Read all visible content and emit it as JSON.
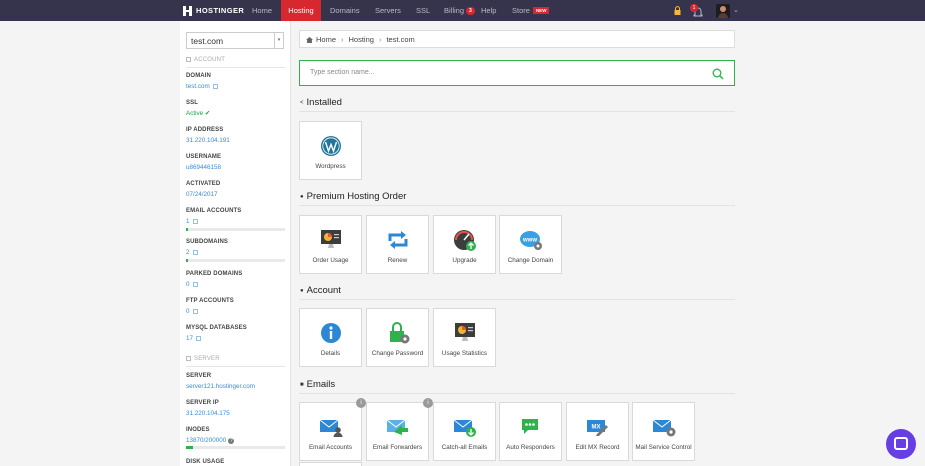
{
  "topnav": {
    "brand": "HOSTINGER",
    "items": [
      {
        "label": "Home"
      },
      {
        "label": "Hosting"
      },
      {
        "label": "Domains"
      },
      {
        "label": "Servers"
      },
      {
        "label": "SSL"
      },
      {
        "label": "Billing",
        "badge": "3"
      },
      {
        "label": "Help"
      },
      {
        "label": "Store",
        "badge": "NEW"
      }
    ],
    "active": "Hosting",
    "notifications_count": "1"
  },
  "sidebar": {
    "selected_domain": "test.com",
    "account_heading": "ACCOUNT",
    "fields": [
      {
        "label": "DOMAIN",
        "value": "test.com"
      },
      {
        "label": "SSL",
        "value": "Active"
      },
      {
        "label": "IP ADDRESS",
        "value": "31.220.104.191"
      },
      {
        "label": "USERNAME",
        "value": "u869446158"
      },
      {
        "label": "ACTIVATED",
        "value": "07/24/2017"
      },
      {
        "label": "EMAIL ACCOUNTS",
        "value": "1"
      },
      {
        "label": "SUBDOMAINS",
        "value": "2"
      },
      {
        "label": "PARKED DOMAINS",
        "value": "0"
      },
      {
        "label": "FTP ACCOUNTS",
        "value": "0"
      },
      {
        "label": "MYSQL DATABASES",
        "value": "17"
      }
    ],
    "usage": {
      "email_accounts": 0.01,
      "subdomains": 0.02,
      "inodes": 0.07
    },
    "server_heading": "SERVER",
    "server_fields": [
      {
        "label": "SERVER",
        "value": "server121.hostinger.com"
      },
      {
        "label": "SERVER IP",
        "value": "31.220.104.175"
      },
      {
        "label": "INODES",
        "value": "13870/200000"
      },
      {
        "label": "DISK USAGE",
        "value": ""
      }
    ]
  },
  "breadcrumb": [
    "Home",
    "Hosting",
    "test.com"
  ],
  "search": {
    "placeholder": "Type section name..."
  },
  "sections": [
    {
      "title": "Installed",
      "tiles": [
        {
          "label": "Wordpress",
          "icon": "wordpress-icon"
        }
      ]
    },
    {
      "title": "Premium Hosting Order",
      "tiles": [
        {
          "label": "Order Usage",
          "icon": "order-usage-icon"
        },
        {
          "label": "Renew",
          "icon": "renew-icon"
        },
        {
          "label": "Upgrade",
          "icon": "upgrade-icon"
        },
        {
          "label": "Change Domain",
          "icon": "change-domain-icon"
        }
      ]
    },
    {
      "title": "Account",
      "tiles": [
        {
          "label": "Details",
          "icon": "info-icon"
        },
        {
          "label": "Change Password",
          "icon": "lock-gear-icon"
        },
        {
          "label": "Usage Statistics",
          "icon": "stats-icon"
        }
      ]
    },
    {
      "title": "Emails",
      "tiles": [
        {
          "label": "Email Accounts",
          "icon": "email-accounts-icon"
        },
        {
          "label": "Email Forwarders",
          "icon": "email-forwarders-icon"
        },
        {
          "label": "Catch-all Emails",
          "icon": "catch-all-icon"
        },
        {
          "label": "Auto Responders",
          "icon": "auto-responders-icon"
        },
        {
          "label": "Edit MX Record",
          "icon": "mx-record-icon"
        },
        {
          "label": "Mail Service Control",
          "icon": "mail-service-icon"
        }
      ]
    }
  ],
  "icon_text": {
    "www": "www",
    "mx": "MX"
  },
  "colors": {
    "topbar": "#36344d",
    "active_nav": "#d7282f",
    "link": "#3a8bd6",
    "success": "#2fb24b",
    "chat": "#673de6"
  }
}
